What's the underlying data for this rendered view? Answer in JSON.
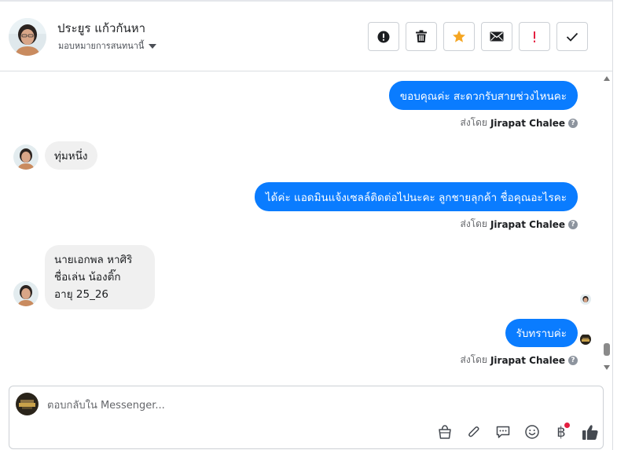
{
  "header": {
    "contact_name": "ประยูร แก้วกันหา",
    "assign_label": "มอบหมายการสนทนานี้",
    "actions": [
      {
        "icon": "alert-circle-icon"
      },
      {
        "icon": "trash-icon"
      },
      {
        "icon": "star-icon"
      },
      {
        "icon": "envelope-icon"
      },
      {
        "icon": "exclamation-icon"
      },
      {
        "icon": "checkmark-icon"
      }
    ]
  },
  "messages": [
    {
      "direction": "out",
      "text": "ขอบคุณค่ะ สะดวกรับสายช่วงไหนคะ",
      "sent_by_prefix": "ส่งโดย",
      "sent_by_name": "Jirapat Chalee"
    },
    {
      "direction": "in",
      "text": "ทุ่มหนึ่ง"
    },
    {
      "direction": "out",
      "text": "ได้ค่ะ แอดมินแจ้งเซลล์ติดต่อไปนะคะ ลูกชายลุกค้า ชื่อคุณอะไรคะ",
      "sent_by_prefix": "ส่งโดย",
      "sent_by_name": "Jirapat Chalee"
    },
    {
      "direction": "in",
      "lines": [
        "นายเอกพล  หาศิริ",
        "ชื่อเล่น  น้องติ๊ก",
        "อายุ  25_26"
      ]
    },
    {
      "direction": "out",
      "text": "รับทราบค่ะ",
      "sent_by_prefix": "ส่งโดย",
      "sent_by_name": "Jirapat Chalee"
    }
  ],
  "composer": {
    "placeholder": "ตอบกลับใน Messenger...",
    "tools": [
      "shopping-bag-icon",
      "paperclip-icon",
      "saved-replies-icon",
      "emoji-icon",
      "baht-payment-icon",
      "thumbs-up-icon"
    ],
    "baht_symbol": "฿"
  },
  "colors": {
    "outgoing_bubble": "#0a7cff",
    "incoming_bubble": "#f0f0f0",
    "star": "#f5a623",
    "alert": "#e41e3f"
  }
}
